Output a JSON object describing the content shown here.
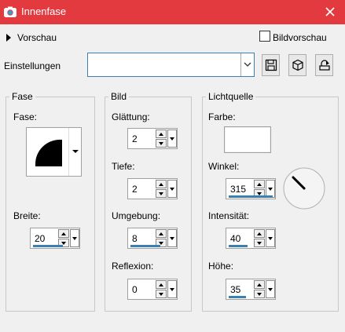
{
  "window": {
    "title": "Innenfase",
    "titlebar_color": "#e33a40"
  },
  "preview": {
    "label": "Vorschau",
    "checkbox_label": "Bildvorschau",
    "checked": false
  },
  "settings": {
    "label": "Einstellungen",
    "value": ""
  },
  "toolbar": {
    "icons": [
      "save-icon",
      "cube-icon",
      "preset-manager-icon"
    ]
  },
  "fase": {
    "group_title": "Fase",
    "fase_label": "Fase:",
    "breite_label": "Breite:",
    "breite_value": "20"
  },
  "bild": {
    "group_title": "Bild",
    "glaettung_label": "Glättung:",
    "glaettung_value": "2",
    "tiefe_label": "Tiefe:",
    "tiefe_value": "2",
    "umgebung_label": "Umgebung:",
    "umgebung_value": "8",
    "reflexion_label": "Reflexion:",
    "reflexion_value": "0"
  },
  "lichtquelle": {
    "group_title": "Lichtquelle",
    "farbe_label": "Farbe:",
    "farbe_color": "#ffffff",
    "winkel_label": "Winkel:",
    "winkel_value": "315",
    "intensitaet_label": "Intensität:",
    "intensitaet_value": "40",
    "hoehe_label": "Höhe:",
    "hoehe_value": "35"
  },
  "colors": {
    "accent": "#3c7fb1",
    "background": "#f0f0f0"
  }
}
